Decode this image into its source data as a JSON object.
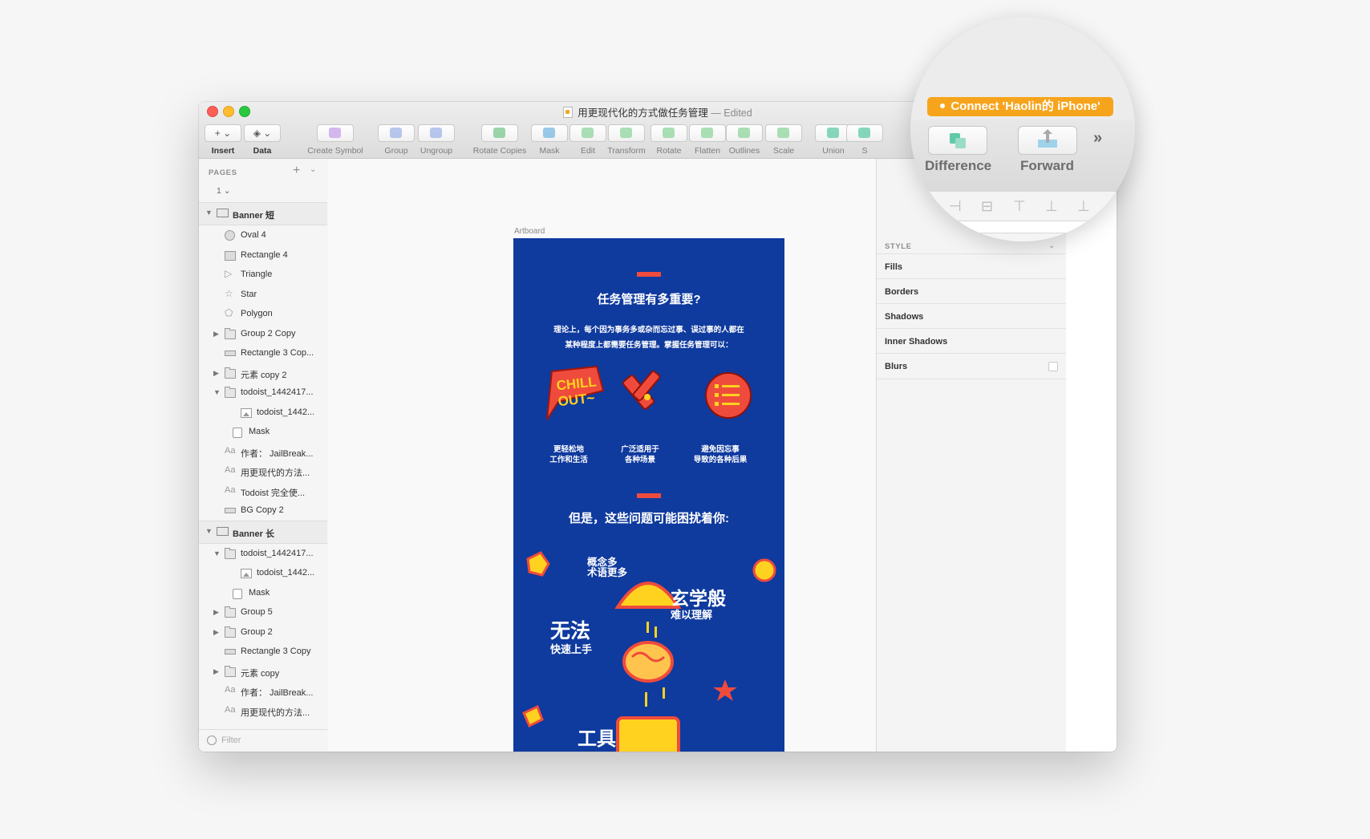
{
  "window": {
    "title": "用更现代化的方式做任务管理",
    "edited": "— Edited",
    "connect_label": "Connect 'Haolin的 iPhone'"
  },
  "toolbar": {
    "items": [
      {
        "label": "Insert",
        "icon": "plus-icon"
      },
      {
        "label": "Data",
        "icon": "layers-icon"
      },
      {
        "label": "Create Symbol",
        "icon": "symbol-icon"
      },
      {
        "label": "Group",
        "icon": "group-icon"
      },
      {
        "label": "Ungroup",
        "icon": "ungroup-icon"
      },
      {
        "label": "Rotate Copies",
        "icon": "rotate-copies-icon"
      },
      {
        "label": "Mask",
        "icon": "mask-icon"
      },
      {
        "label": "Edit",
        "icon": "edit-icon"
      },
      {
        "label": "Transform",
        "icon": "transform-icon"
      },
      {
        "label": "Rotate",
        "icon": "rotate-icon"
      },
      {
        "label": "Flatten",
        "icon": "flatten-icon"
      },
      {
        "label": "Outlines",
        "icon": "outlines-icon"
      },
      {
        "label": "Scale",
        "icon": "scale-icon"
      },
      {
        "label": "Union",
        "icon": "union-icon"
      },
      {
        "label": "S",
        "icon": "subtract-icon"
      }
    ],
    "magnified": {
      "difference": "Difference",
      "forward": "Forward"
    }
  },
  "sidebar": {
    "pages_header": "PAGES",
    "current_page": "1",
    "artboards": [
      {
        "name": "Banner 短",
        "layers": [
          {
            "name": "Oval 4",
            "type": "oval"
          },
          {
            "name": "Rectangle 4",
            "type": "rect"
          },
          {
            "name": "Triangle",
            "type": "triangle"
          },
          {
            "name": "Star",
            "type": "star"
          },
          {
            "name": "Polygon",
            "type": "polygon"
          },
          {
            "name": "Group 2 Copy",
            "type": "folder",
            "collapsed": true
          },
          {
            "name": "Rectangle 3 Cop...",
            "type": "thin"
          },
          {
            "name": "元素 copy 2",
            "type": "folder",
            "collapsed": true
          },
          {
            "name": "todoist_1442417...",
            "type": "folder",
            "expanded": true
          },
          {
            "name": "todoist_1442...",
            "type": "img",
            "indent": 2
          },
          {
            "name": "Mask",
            "type": "mask",
            "indent": 1
          },
          {
            "name": "作者： JailBreak...",
            "type": "txt"
          },
          {
            "name": "用更现代的方法...",
            "type": "txt"
          },
          {
            "name": "Todoist 完全使...",
            "type": "txt"
          },
          {
            "name": "BG Copy 2",
            "type": "thin"
          }
        ]
      },
      {
        "name": "Banner 长",
        "layers": [
          {
            "name": "todoist_1442417...",
            "type": "folder",
            "expanded": true
          },
          {
            "name": "todoist_1442...",
            "type": "img",
            "indent": 2
          },
          {
            "name": "Mask",
            "type": "mask",
            "indent": 1
          },
          {
            "name": "Group 5",
            "type": "folder",
            "collapsed": true
          },
          {
            "name": "Group 2",
            "type": "folder",
            "collapsed": true
          },
          {
            "name": "Rectangle 3 Copy",
            "type": "thin"
          },
          {
            "name": "元素 copy",
            "type": "folder",
            "collapsed": true
          },
          {
            "name": "作者： JailBreak...",
            "type": "txt"
          },
          {
            "name": "用更现代的方法...",
            "type": "txt"
          }
        ]
      }
    ],
    "filter_placeholder": "Filter"
  },
  "canvas": {
    "artboard_label": "Artboard",
    "artboard": {
      "heading1": "任务管理有多重要?",
      "intro_line1": "理论上，每个因为事务多或杂而忘过事、误过事的人都在",
      "intro_line2": "某种程度上都需要任务管理。掌握任务管理可以：",
      "chill_line1": "CHILL",
      "chill_line2": "OUT~",
      "benefits": [
        {
          "line1": "更轻松地",
          "line2": "工作和生活"
        },
        {
          "line1": "广泛适用于",
          "line2": "各种场景"
        },
        {
          "line1": "避免因忘事",
          "line2": "导致的各种后果"
        }
      ],
      "heading2": "但是，这些问题可能困扰着你:",
      "problem_concepts1": "概念多",
      "problem_concepts2": "术语更多",
      "problem_mystic1": "玄学般",
      "problem_mystic2": "难以理解",
      "problem_hard1": "无法",
      "problem_hard2": "快速上手",
      "problem_tools": "工具"
    },
    "colors": {
      "artboard_bg": "#0f3a9e",
      "accent_red": "#ef4b3c",
      "accent_yellow": "#ffd21f"
    }
  },
  "inspector": {
    "style_header": "STYLE",
    "properties": [
      "Fills",
      "Borders",
      "Shadows",
      "Inner Shadows",
      "Blurs"
    ]
  }
}
